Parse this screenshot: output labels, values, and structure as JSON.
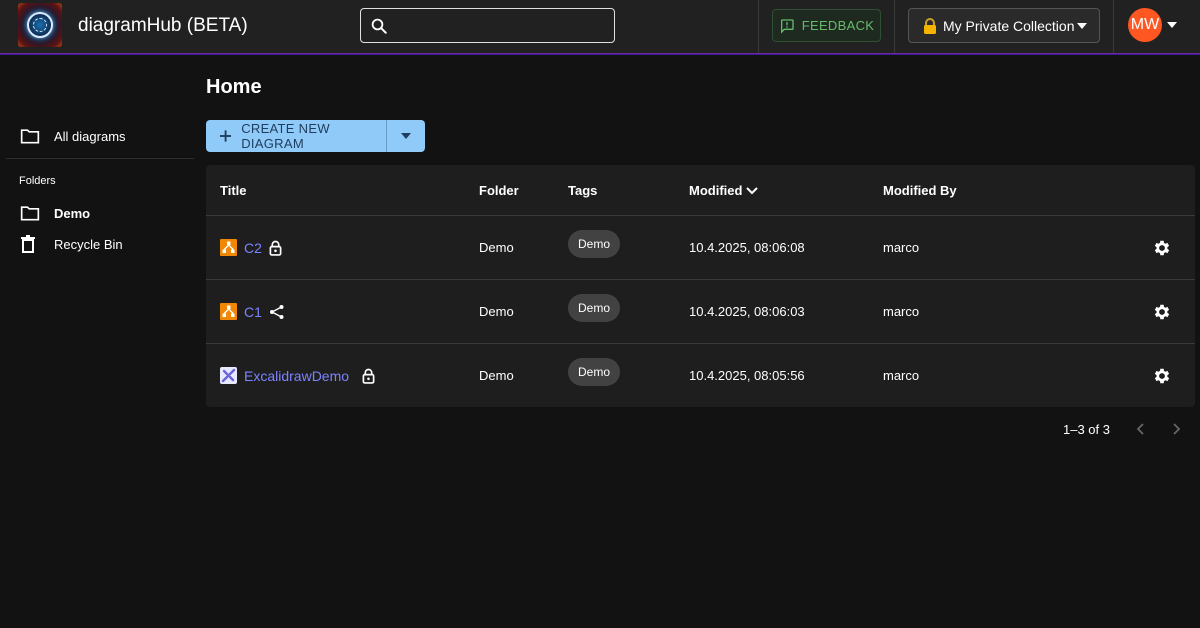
{
  "header": {
    "app_title": "diagramHub (BETA)",
    "search": {
      "value": "",
      "placeholder": ""
    },
    "feedback_label": "FEEDBACK",
    "collection_label": "My Private Collection",
    "avatar_initials": "MW"
  },
  "sidebar": {
    "all_diagrams": "All diagrams",
    "folders_heading": "Folders",
    "folders": [
      {
        "label": "Demo",
        "active": true
      },
      {
        "label": "Recycle Bin",
        "active": false
      }
    ]
  },
  "main": {
    "page_title": "Home",
    "create_label": "CREATE NEW DIAGRAM",
    "columns": {
      "title": "Title",
      "folder": "Folder",
      "tags": "Tags",
      "modified": "Modified",
      "modified_by": "Modified By"
    },
    "rows": [
      {
        "title": "C2",
        "type": "drawio",
        "status_icon": "lock-icon",
        "folder": "Demo",
        "tag": "Demo",
        "modified": "10.4.2025, 08:06:08",
        "modified_by": "marco"
      },
      {
        "title": "C1",
        "type": "drawio",
        "status_icon": "share-icon",
        "folder": "Demo",
        "tag": "Demo",
        "modified": "10.4.2025, 08:06:03",
        "modified_by": "marco"
      },
      {
        "title": "ExcalidrawDemo",
        "type": "excalidraw",
        "status_icon": "lock-icon",
        "folder": "Demo",
        "tag": "Demo",
        "modified": "10.4.2025, 08:05:56",
        "modified_by": "marco"
      }
    ],
    "pagination": "1–3 of 3"
  },
  "colors": {
    "accent_blue": "#90caf9",
    "link": "#7c83ff",
    "feedback_green": "#66bb6a",
    "avatar": "#ff5722",
    "drawio_orange": "#f08705"
  }
}
